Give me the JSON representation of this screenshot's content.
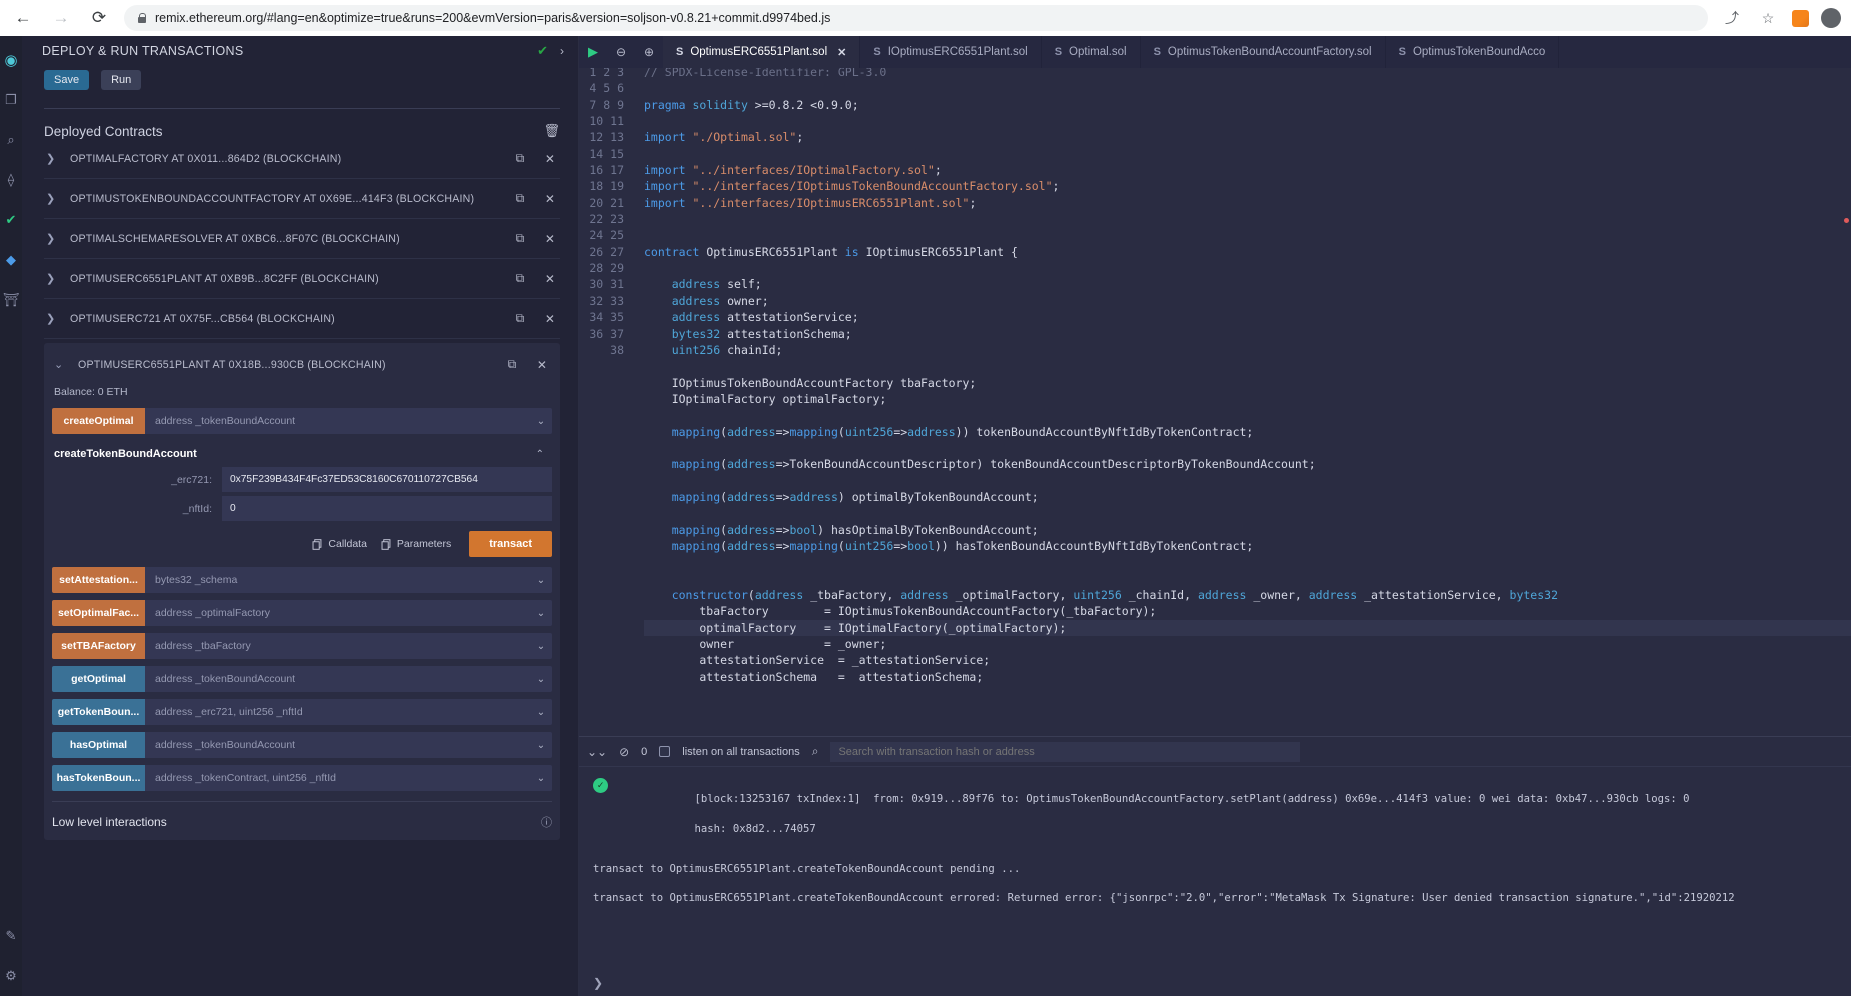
{
  "browser": {
    "back_icon": "arrow-left-icon",
    "forward_icon": "arrow-right-icon",
    "reload_icon": "reload-icon",
    "url": "remix.ethereum.org/#lang=en&optimize=true&runs=200&evmVersion=paris&version=soljson-v0.8.21+commit.d9974bed.js",
    "share_icon": "share-icon",
    "bookmark_icon": "star-icon",
    "extension_icon": "metamask-icon",
    "profile_icon": "profile-avatar"
  },
  "rail": {
    "items": [
      {
        "name": "remix-logo",
        "glyph": "◉"
      },
      {
        "name": "file-explorer-icon",
        "glyph": "❐"
      },
      {
        "name": "search-icon",
        "glyph": "⌕"
      },
      {
        "name": "solidity-compiler-icon",
        "glyph": "⟠"
      },
      {
        "name": "compiler-ok-icon",
        "glyph": "✔"
      },
      {
        "name": "deploy-run-icon",
        "glyph": "◆"
      },
      {
        "name": "debugger-icon",
        "glyph": "🏛"
      },
      {
        "name": "plugin-manager-icon",
        "glyph": "✎"
      },
      {
        "name": "settings-icon",
        "glyph": "⚙"
      }
    ]
  },
  "left_panel": {
    "title": "DEPLOY & RUN TRANSACTIONS",
    "header_check_icon": "check-icon",
    "header_chevron_icon": "chevron-right-icon",
    "save_label": "Save",
    "run_label": "Run",
    "deployed_contracts_title": "Deployed Contracts",
    "trash_icon": "trash-icon",
    "contracts": [
      {
        "label": "OPTIMALFACTORY AT 0X011...864D2 (BLOCKCHAIN)",
        "expanded": false
      },
      {
        "label": "OPTIMUSTOKENBOUNDACCOUNTFACTORY AT 0X69E...414F3 (BLOCKCHAIN)",
        "expanded": false
      },
      {
        "label": "OPTIMALSCHEMARESOLVER AT 0XBC6...8F07C (BLOCKCHAIN)",
        "expanded": false
      },
      {
        "label": "OPTIMUSERC6551PLANT AT 0XB9B...8C2FF (BLOCKCHAIN)",
        "expanded": false
      },
      {
        "label": "OPTIMUSERC721 AT 0X75F...CB564 (BLOCKCHAIN)",
        "expanded": false
      }
    ],
    "active_contract": {
      "label": "OPTIMUSERC6551PLANT AT 0X18B...930CB (BLOCKCHAIN)",
      "copy_icon": "copy-icon",
      "close_icon": "close-icon",
      "balance": "Balance: 0 ETH"
    },
    "create_optimal": {
      "button": "createOptimal",
      "args": "address _tokenBoundAccount"
    },
    "expanded_function": {
      "title": "createTokenBoundAccount",
      "collapse_icon": "chevron-up-icon",
      "inputs": [
        {
          "label": "_erc721:",
          "value": "0x75F239B434F4Fc37ED53C8160C670110727CB564"
        },
        {
          "label": "_nftId:",
          "value": "0"
        }
      ],
      "calldata_label": "Calldata",
      "parameters_label": "Parameters",
      "transact_label": "transact"
    },
    "functions": [
      {
        "button": "setAttestation...",
        "args": "bytes32 _schema",
        "kind": "write"
      },
      {
        "button": "setOptimalFac...",
        "args": "address _optimalFactory",
        "kind": "write"
      },
      {
        "button": "setTBAFactory",
        "args": "address _tbaFactory",
        "kind": "write"
      },
      {
        "button": "getOptimal",
        "args": "address _tokenBoundAccount",
        "kind": "read"
      },
      {
        "button": "getTokenBoun...",
        "args": "address _erc721, uint256 _nftId",
        "kind": "read"
      },
      {
        "button": "hasOptimal",
        "args": "address _tokenBoundAccount",
        "kind": "read"
      },
      {
        "button": "hasTokenBoun...",
        "args": "address _tokenContract, uint256 _nftId",
        "kind": "read"
      }
    ],
    "low_level": {
      "title": "Low level interactions",
      "info_icon": "info-icon"
    }
  },
  "editor": {
    "toolbar": {
      "run_icon": "play-icon",
      "zoom_out_icon": "zoom-out-icon",
      "zoom_in_icon": "zoom-in-icon"
    },
    "tabs": [
      {
        "label": "OptimusERC6551Plant.sol",
        "active": true,
        "closable": true
      },
      {
        "label": "IOptimusERC6551Plant.sol",
        "active": false,
        "closable": false
      },
      {
        "label": "Optimal.sol",
        "active": false,
        "closable": false
      },
      {
        "label": "OptimusTokenBoundAccountFactory.sol",
        "active": false,
        "closable": false
      },
      {
        "label": "OptimusTokenBoundAcco",
        "active": false,
        "closable": false
      }
    ],
    "first_line_number": 1,
    "highlight_line": 35,
    "lines": [
      "// SPDX-License-Identifier: GPL-3.0",
      "",
      "pragma solidity >=0.8.2 <0.9.0;",
      "",
      "import \"./Optimal.sol\";",
      "",
      "import \"../interfaces/IOptimalFactory.sol\";",
      "import \"../interfaces/IOptimusTokenBoundAccountFactory.sol\";",
      "import \"../interfaces/IOptimusERC6551Plant.sol\";",
      "",
      "",
      "contract OptimusERC6551Plant is IOptimusERC6551Plant {",
      "",
      "    address self;",
      "    address owner;",
      "    address attestationService;",
      "    bytes32 attestationSchema;",
      "    uint256 chainId;",
      "",
      "    IOptimusTokenBoundAccountFactory tbaFactory;",
      "    IOptimalFactory optimalFactory;",
      "",
      "    mapping(address=>mapping(uint256=>address)) tokenBoundAccountByNftIdByTokenContract;",
      "",
      "    mapping(address=>TokenBoundAccountDescriptor) tokenBoundAccountDescriptorByTokenBoundAccount;",
      "",
      "    mapping(address=>address) optimalByTokenBoundAccount;",
      "",
      "    mapping(address=>bool) hasOptimalByTokenBoundAccount;",
      "    mapping(address=>mapping(uint256=>bool)) hasTokenBoundAccountByNftIdByTokenContract;",
      "",
      "",
      "    constructor(address _tbaFactory, address _optimalFactory, uint256 _chainId, address _owner, address _attestationService, bytes32",
      "        tbaFactory        = IOptimusTokenBoundAccountFactory(_tbaFactory);",
      "        optimalFactory    = IOptimalFactory(_optimalFactory);",
      "        owner             = _owner;",
      "        attestationService  = _attestationService;",
      "        attestationSchema   =  attestationSchema;"
    ]
  },
  "terminal": {
    "collapse_icon": "chevron-double-down-icon",
    "clear_icon": "ban-icon",
    "count": "0",
    "listen_label": "listen on all transactions",
    "search_icon": "search-icon",
    "search_placeholder": "Search with transaction hash or address",
    "entries": [
      {
        "type": "success",
        "status_icon": "check-circle-icon",
        "line1": "[block:13253167 txIndex:1]  from: 0x919...89f76 to: OptimusTokenBoundAccountFactory.setPlant(address) 0x69e...414f3 value: 0 wei data: 0xb47...930cb logs: 0",
        "line2": "hash: 0x8d2...74057"
      }
    ],
    "plain_lines": [
      "transact to OptimusERC6551Plant.createTokenBoundAccount pending ... ",
      "transact to OptimusERC6551Plant.createTokenBoundAccount errored: Returned error: {\"jsonrpc\":\"2.0\",\"error\":\"MetaMask Tx Signature: User denied transaction signature.\",\"id\":21920212"
    ],
    "prompt_icon": "chevron-right-icon"
  }
}
